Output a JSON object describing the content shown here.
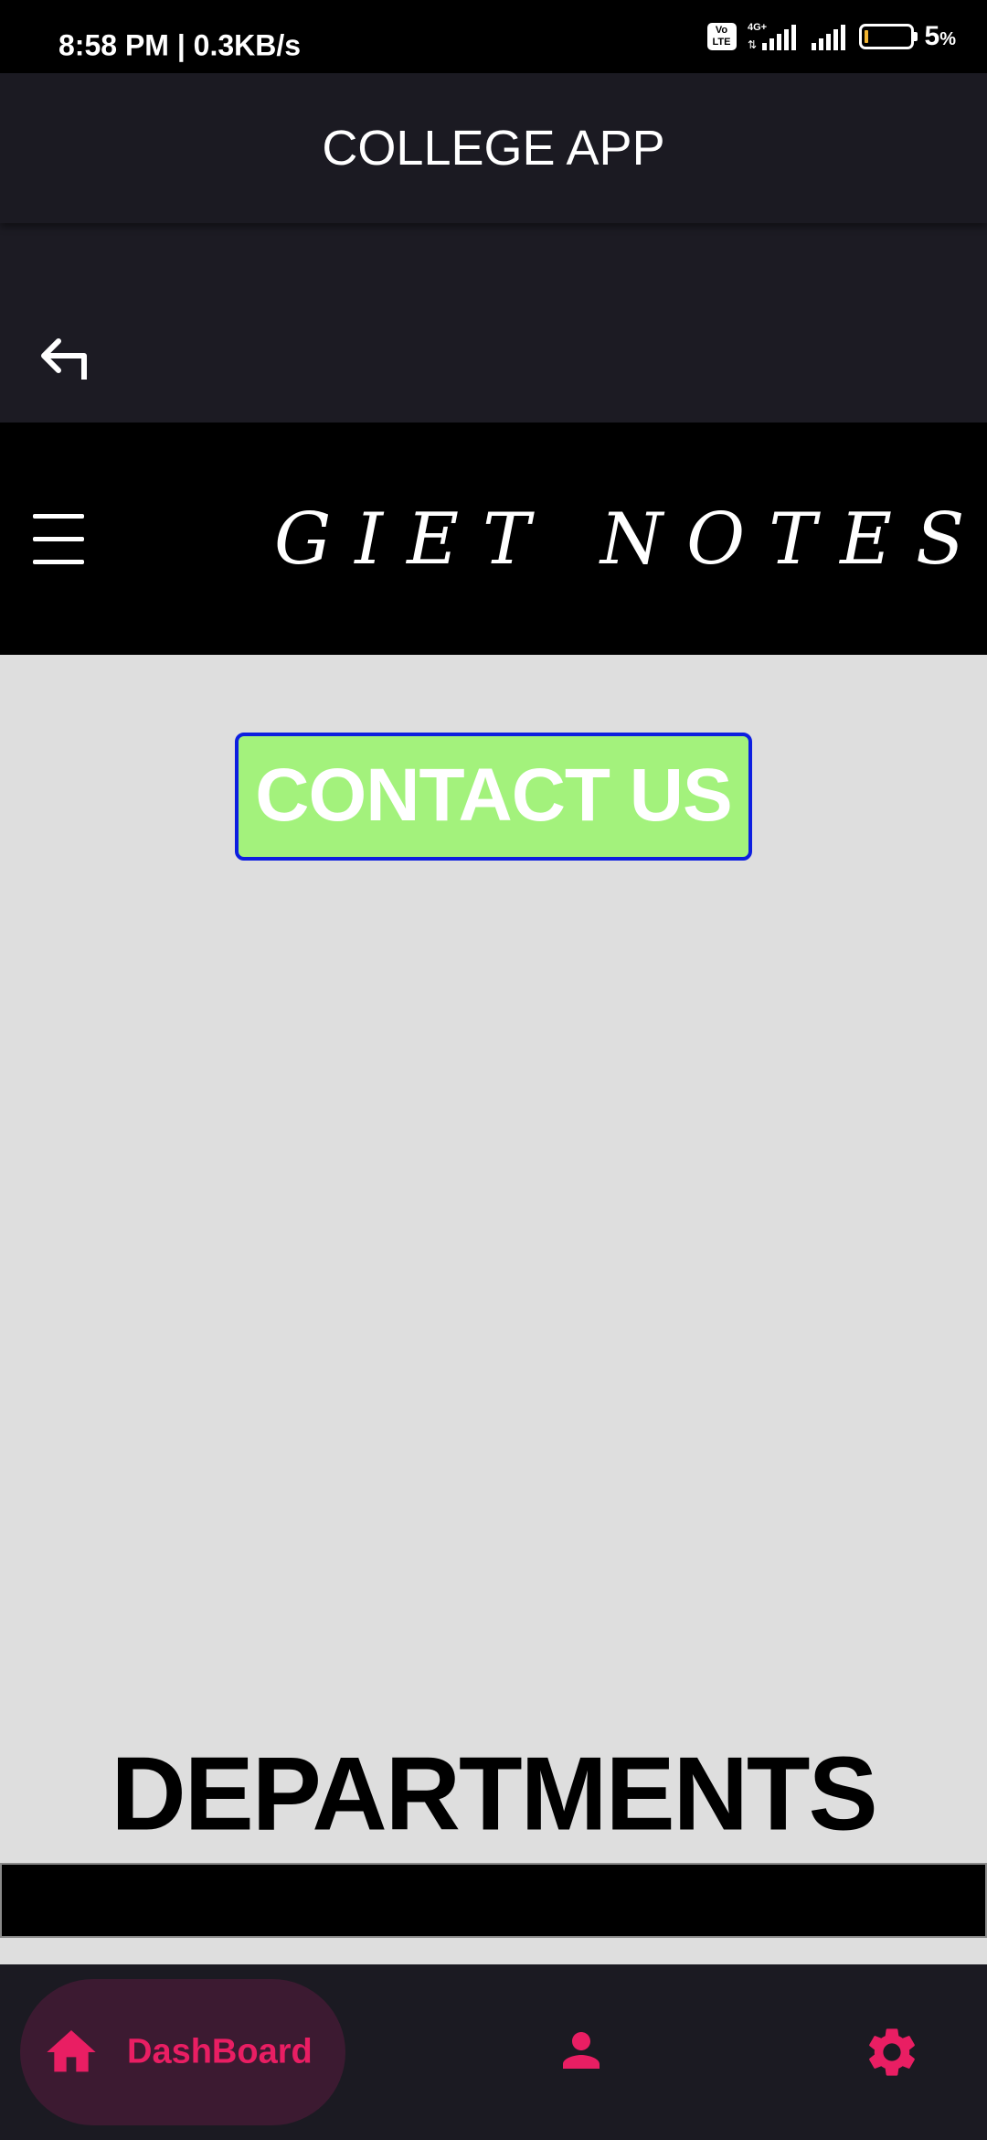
{
  "status_bar": {
    "time": "8:58 PM | 0.3KB/s",
    "volte_label": "Vo\nLTE",
    "network": "4G+",
    "battery_percent": "5",
    "battery_unit": "%"
  },
  "app_bar": {
    "title": "COLLEGE APP"
  },
  "back": {
    "icon": "back-arrow-icon"
  },
  "header": {
    "menu_icon": "hamburger-menu-icon",
    "title": "GIET NOTES"
  },
  "contact": {
    "label": "CONTACT US"
  },
  "departments": {
    "title": "DEPARTMENTS"
  },
  "bottom_nav": {
    "items": [
      {
        "label": "DashBoard",
        "icon": "home-icon",
        "selected": true
      },
      {
        "label": "",
        "icon": "person-icon",
        "selected": false
      },
      {
        "label": "",
        "icon": "gear-icon",
        "selected": false
      }
    ]
  },
  "colors": {
    "accent": "#e91e63",
    "contact_fill": "#a3f27c",
    "contact_border": "#0d1fe0",
    "app_bar": "#1b1a22",
    "content_bg": "#dedede"
  }
}
